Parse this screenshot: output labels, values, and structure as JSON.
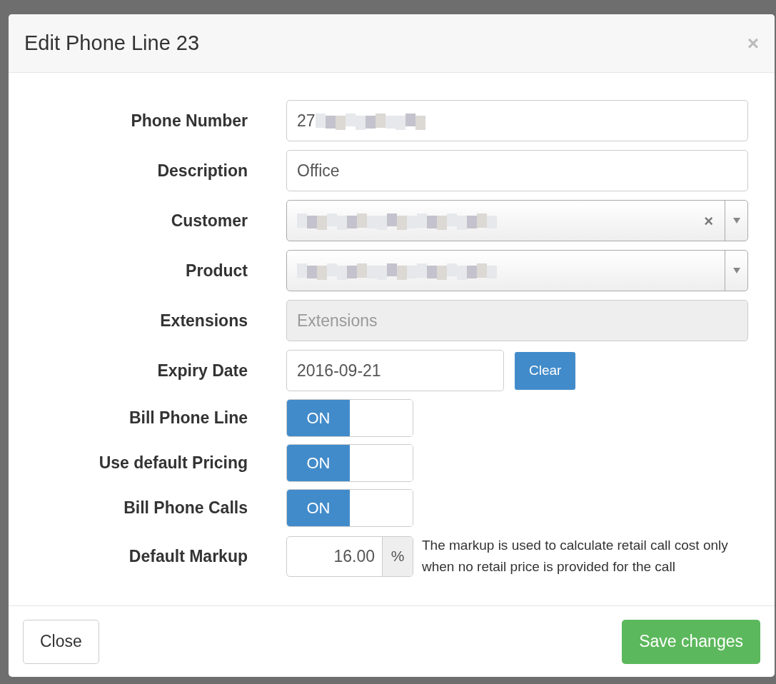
{
  "modal": {
    "title": "Edit Phone Line 23",
    "close_icon": "×"
  },
  "fields": [
    {
      "kind": "text",
      "label": "Phone Number",
      "value": "27",
      "redacted": true
    },
    {
      "kind": "text",
      "label": "Description",
      "value": "Office"
    },
    {
      "kind": "select",
      "label": "Customer",
      "redacted": true,
      "clear_icon": "×"
    },
    {
      "kind": "select",
      "label": "Product",
      "redacted": true
    },
    {
      "kind": "text",
      "label": "Extensions",
      "placeholder": "Extensions",
      "disabled": true
    },
    {
      "kind": "date",
      "label": "Expiry Date",
      "value": "2016-09-21",
      "button": "Clear"
    },
    {
      "kind": "toggle",
      "label": "Bill Phone Line",
      "on": true,
      "on_text": "ON"
    },
    {
      "kind": "toggle",
      "label": "Use default Pricing",
      "on": true,
      "on_text": "ON"
    },
    {
      "kind": "toggle",
      "label": "Bill Phone Calls",
      "on": true,
      "on_text": "ON"
    },
    {
      "kind": "markup",
      "label": "Default Markup",
      "value": "16.00",
      "addon": "%",
      "help": "The markup is used to calculate retail call cost only when no retail price is provided for the call"
    }
  ],
  "footer": {
    "close": "Close",
    "save": "Save changes"
  }
}
